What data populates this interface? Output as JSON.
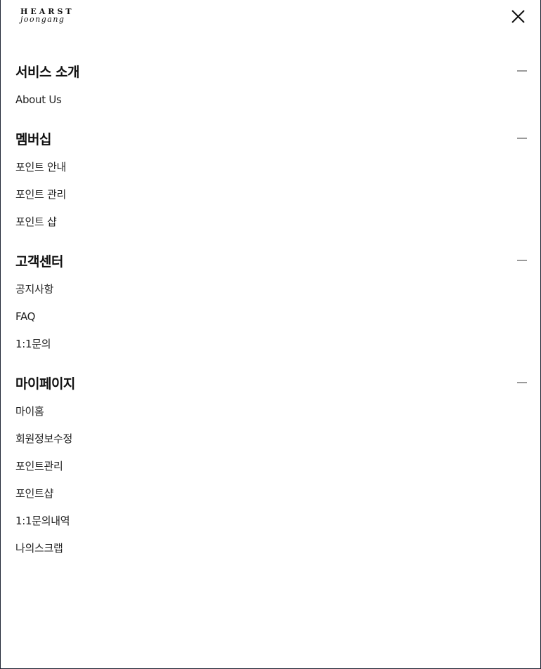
{
  "header": {
    "logo_top": "HEARST",
    "logo_bottom": "joongang"
  },
  "menu": {
    "sections": [
      {
        "title": "서비스 소개",
        "items": [
          "About Us"
        ]
      },
      {
        "title": "멤버십",
        "items": [
          "포인트 안내",
          "포인트 관리",
          "포인트 샵"
        ]
      },
      {
        "title": "고객센터",
        "items": [
          "공지사항",
          "FAQ",
          "1:1문의"
        ]
      },
      {
        "title": "마이페이지",
        "items": [
          "마이홈",
          "회원정보수정",
          "포인트관리",
          "포인트샵",
          "1:1문의내역",
          "나의스크랩"
        ]
      }
    ]
  },
  "icons": {
    "close": "close-icon",
    "collapse": "minus-icon"
  },
  "colors": {
    "frame_border": "#1d2433",
    "text": "#111111",
    "toggle": "#9a9a9a"
  }
}
